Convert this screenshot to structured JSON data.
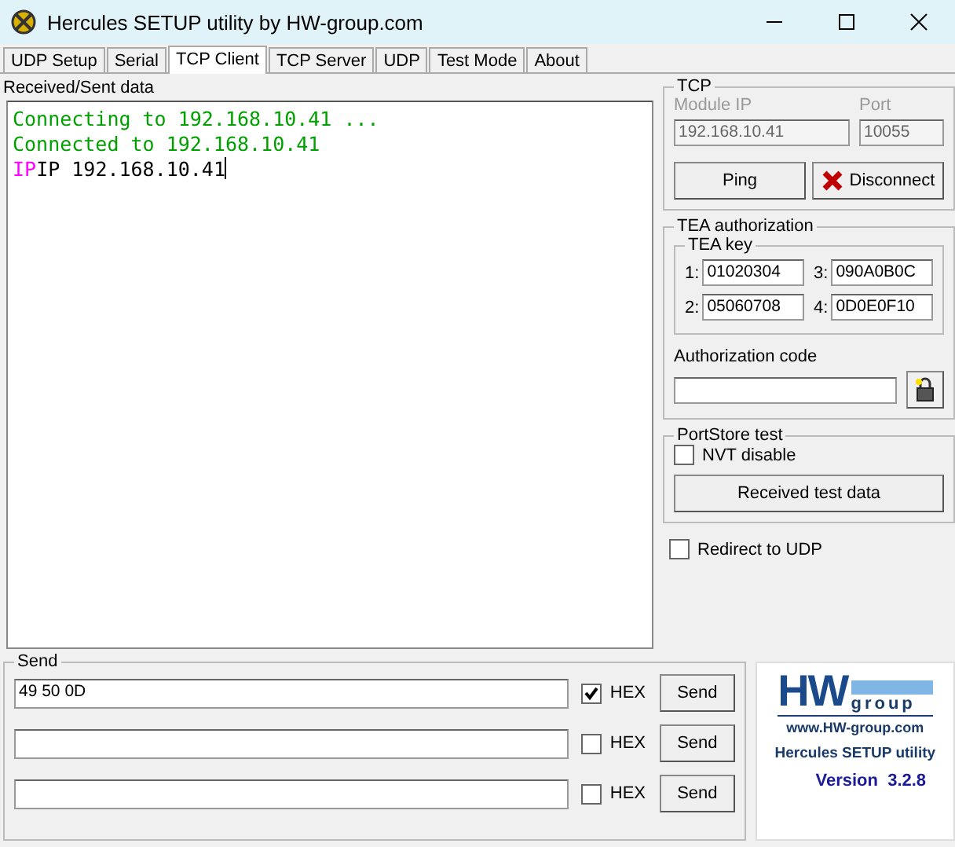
{
  "window": {
    "title": "Hercules SETUP utility by HW-group.com"
  },
  "tabs": [
    {
      "label": "UDP Setup",
      "selected": false
    },
    {
      "label": "Serial",
      "selected": false
    },
    {
      "label": "TCP Client",
      "selected": true
    },
    {
      "label": "TCP Server",
      "selected": false
    },
    {
      "label": "UDP",
      "selected": false
    },
    {
      "label": "Test Mode",
      "selected": false
    },
    {
      "label": "About",
      "selected": false
    }
  ],
  "log": {
    "label": "Received/Sent data",
    "lines": [
      [
        {
          "text": "Connecting to 192.168.10.41 ...",
          "color": "#00a000"
        }
      ],
      [
        {
          "text": "Connected to 192.168.10.41",
          "color": "#00a000"
        }
      ],
      [
        {
          "text": "IP",
          "color": "#ff00ff"
        },
        {
          "text": "IP 192.168.10.41",
          "color": "#000000"
        }
      ]
    ]
  },
  "tcp": {
    "title": "TCP",
    "module_ip": {
      "label": "Module IP",
      "value": "192.168.10.41",
      "disabled": true
    },
    "port": {
      "label": "Port",
      "value": "10055",
      "disabled": true
    },
    "ping": "Ping",
    "disconnect": "Disconnect"
  },
  "tea": {
    "title": "TEA authorization",
    "key_title": "TEA key",
    "keys": [
      {
        "label": "1:",
        "value": "01020304"
      },
      {
        "label": "3:",
        "value": "090A0B0C"
      },
      {
        "label": "2:",
        "value": "05060708"
      },
      {
        "label": "4:",
        "value": "0D0E0F10"
      }
    ],
    "auth_label": "Authorization code"
  },
  "portstore": {
    "title": "PortStore test",
    "nvt": {
      "label": "NVT disable",
      "checked": false
    },
    "button": "Received test data"
  },
  "redirect": {
    "label": "Redirect to UDP",
    "checked": false
  },
  "send": {
    "title": "Send",
    "rows": [
      {
        "value": "49 50 0D",
        "hex": {
          "label": "HEX",
          "checked": true
        },
        "button": "Send"
      },
      {
        "hex": {
          "label": "HEX",
          "checked": false
        },
        "button": "Send"
      },
      {
        "hex": {
          "label": "HEX",
          "checked": false
        },
        "button": "Send"
      }
    ]
  },
  "logo": {
    "mark": "HW",
    "group": "group",
    "url": "www.HW-group.com",
    "product": "Hercules SETUP utility",
    "version": "Version  3.2.8"
  }
}
